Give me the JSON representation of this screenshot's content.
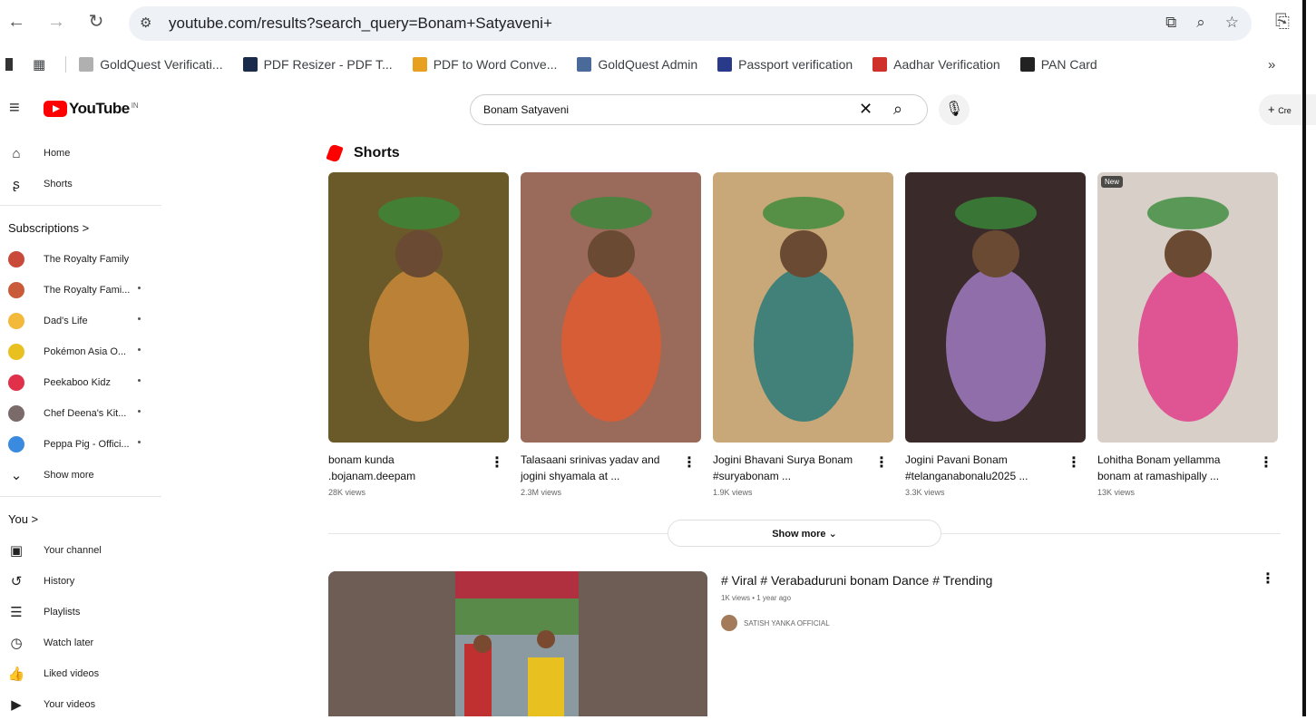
{
  "browser": {
    "url": "youtube.com/results?search_query=Bonam+Satyaveni+",
    "bookmarks": [
      {
        "label": "GoldQuest Verificati...",
        "color": "#b0b0b0"
      },
      {
        "label": "PDF Resizer - PDF T...",
        "color": "#1a2a4a"
      },
      {
        "label": "PDF to Word Conve...",
        "color": "#e8a020"
      },
      {
        "label": "GoldQuest Admin",
        "color": "#4a6a9a"
      },
      {
        "label": "Passport verification",
        "color": "#2a3a8a"
      },
      {
        "label": "Aadhar Verification",
        "color": "#d0302a"
      },
      {
        "label": "PAN Card",
        "color": "#222222"
      }
    ],
    "more_bookmarks": "»"
  },
  "header": {
    "logo_text": "YouTube",
    "logo_sup": "IN",
    "search_value": "Bonam Satyaveni",
    "create_label": "Cre"
  },
  "sidebar": {
    "main": [
      {
        "label": "Home",
        "icon": "⌂"
      },
      {
        "label": "Shorts",
        "icon": "ʂ"
      }
    ],
    "subscriptions_header": "Subscriptions  >",
    "subscriptions": [
      {
        "label": "The Royalty Family",
        "color": "#c94a3a",
        "dot": false
      },
      {
        "label": "The Royalty Fami...",
        "color": "#c95a3a",
        "dot": true
      },
      {
        "label": "Dad's Life",
        "color": "#f2b93b",
        "dot": true
      },
      {
        "label": "Pokémon Asia O...",
        "color": "#e8c020",
        "dot": true
      },
      {
        "label": "Peekaboo Kidz",
        "color": "#e0304a",
        "dot": true
      },
      {
        "label": "Chef Deena's Kit...",
        "color": "#7a6a6a",
        "dot": true
      },
      {
        "label": "Peppa Pig - Offici...",
        "color": "#3a8ae0",
        "dot": true
      }
    ],
    "show_more": "Show more",
    "you_header": "You  >",
    "you_items": [
      {
        "label": "Your channel",
        "icon": "▣"
      },
      {
        "label": "History",
        "icon": "↺"
      },
      {
        "label": "Playlists",
        "icon": "☰"
      },
      {
        "label": "Watch later",
        "icon": "◷"
      },
      {
        "label": "Liked videos",
        "icon": "👍"
      },
      {
        "label": "Your videos",
        "icon": "▶"
      }
    ]
  },
  "shorts": {
    "title": "Shorts",
    "items": [
      {
        "title": "bonam kunda .bojanam.deepam",
        "views": "28K views",
        "bg": "#6a5a2a",
        "accent": "#c98a3a",
        "badge": ""
      },
      {
        "title": "Talasaani srinivas yadav and jogini shyamala at ...",
        "views": "2.3M views",
        "bg": "#9a6a5a",
        "accent": "#e05a30",
        "badge": ""
      },
      {
        "title": "Jogini Bhavani Surya Bonam #suryabonam ...",
        "views": "1.9K views",
        "bg": "#c8a878",
        "accent": "#2a7a7a",
        "badge": ""
      },
      {
        "title": "Jogini Pavani Bonam #telanganabonalu2025 ...",
        "views": "3.3K views",
        "bg": "#3a2a2a",
        "accent": "#a07ac0",
        "badge": ""
      },
      {
        "title": "Lohitha Bonam yellamma bonam at ramashipally ...",
        "views": "13K views",
        "bg": "#d8d0c8",
        "accent": "#e0408a",
        "badge": "New"
      }
    ],
    "show_more": "Show more"
  },
  "video": {
    "title": "# Viral # Verabaduruni bonam Dance # Trending",
    "meta": "1K views • 1 year ago",
    "channel": "SATISH YANKA OFFICIAL"
  }
}
